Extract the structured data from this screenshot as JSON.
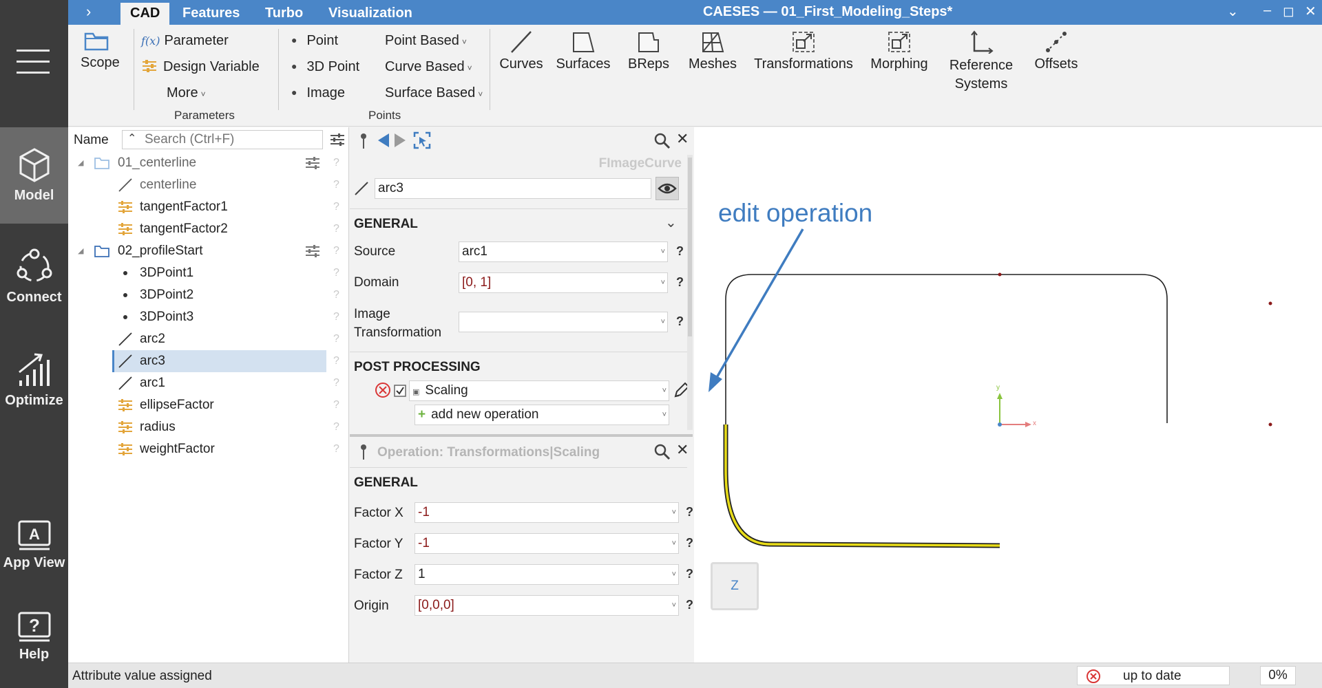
{
  "activity_bar": {
    "items": [
      {
        "label": "Model",
        "icon": "cube-icon"
      },
      {
        "label": "Connect",
        "icon": "connect-icon"
      },
      {
        "label": "Optimize",
        "icon": "chart-icon"
      },
      {
        "label": "App View",
        "icon": "app-view-icon"
      },
      {
        "label": "Help",
        "icon": "help-icon"
      }
    ]
  },
  "titlebar": {
    "tabs": [
      "CAD",
      "Features",
      "Turbo",
      "Visualization"
    ],
    "active_tab": "CAD",
    "window_title": "CAESES — 01_First_Modeling_Steps*"
  },
  "ribbon": {
    "scope": "Scope",
    "parameter": "Parameter",
    "parameter_fx": "f(x)",
    "design_variable": "Design Variable",
    "more": "More",
    "parameters_group": "Parameters",
    "point": "Point",
    "point_3d": "3D Point",
    "image": "Image",
    "point_based": "Point Based",
    "curve_based": "Curve Based",
    "surface_based": "Surface Based",
    "points_group": "Points",
    "curves": "Curves",
    "surfaces": "Surfaces",
    "breps": "BReps",
    "meshes": "Meshes",
    "transformations": "Transformations",
    "morphing": "Morphing",
    "reference_systems_1": "Reference",
    "reference_systems_2": "Systems",
    "offsets": "Offsets"
  },
  "tree": {
    "header_name": "Name",
    "search_placeholder": "Search (Ctrl+F)",
    "items": [
      {
        "label": "01_centerline",
        "type": "folder-light"
      },
      {
        "label": "centerline",
        "type": "curve-grey"
      },
      {
        "label": "tangentFactor1",
        "type": "variable"
      },
      {
        "label": "tangentFactor2",
        "type": "variable"
      },
      {
        "label": "02_profileStart",
        "type": "folder"
      },
      {
        "label": "3DPoint1",
        "type": "point"
      },
      {
        "label": "3DPoint2",
        "type": "point"
      },
      {
        "label": "3DPoint3",
        "type": "point"
      },
      {
        "label": "arc2",
        "type": "curve"
      },
      {
        "label": "arc3",
        "type": "curve",
        "selected": true
      },
      {
        "label": "arc1",
        "type": "curve"
      },
      {
        "label": "ellipseFactor",
        "type": "variable"
      },
      {
        "label": "radius",
        "type": "variable"
      },
      {
        "label": "weightFactor",
        "type": "variable"
      }
    ],
    "help_mark": "?"
  },
  "props": {
    "type_label": "FImageCurve",
    "name_value": "arc3",
    "general": "GENERAL",
    "source_label": "Source",
    "source_value": "arc1",
    "domain_label": "Domain",
    "domain_value": "[0, 1]",
    "image_transformation_label_1": "Image",
    "image_transformation_label_2": "Transformation",
    "image_transformation_value": "",
    "post_processing": "POST PROCESSING",
    "op_value": "Scaling",
    "add_op": "add new operation",
    "help_mark": "?"
  },
  "operation": {
    "title": "Operation: Transformations|Scaling",
    "general": "GENERAL",
    "factor_x_label": "Factor  X",
    "factor_x_value": "-1",
    "factor_y_label": "Factor  Y",
    "factor_y_value": "-1",
    "factor_z_label": "Factor  Z",
    "factor_z_value": "1",
    "origin_label": "Origin",
    "origin_value": "[0,0,0]"
  },
  "viewport": {
    "annotation": "edit operation",
    "annotation_color": "#3f7cc0",
    "axis_y": "y",
    "axis_x": "x",
    "view_cube": "Z"
  },
  "status": {
    "message": "Attribute value assigned",
    "state": "up to date",
    "percent": "0%"
  },
  "colors": {
    "accent": "#4a86c8",
    "selection": "#d3e1f0",
    "variable_icon": "#e3a53a",
    "error": "#d93636",
    "highlight_curve": "#e8dc18"
  }
}
